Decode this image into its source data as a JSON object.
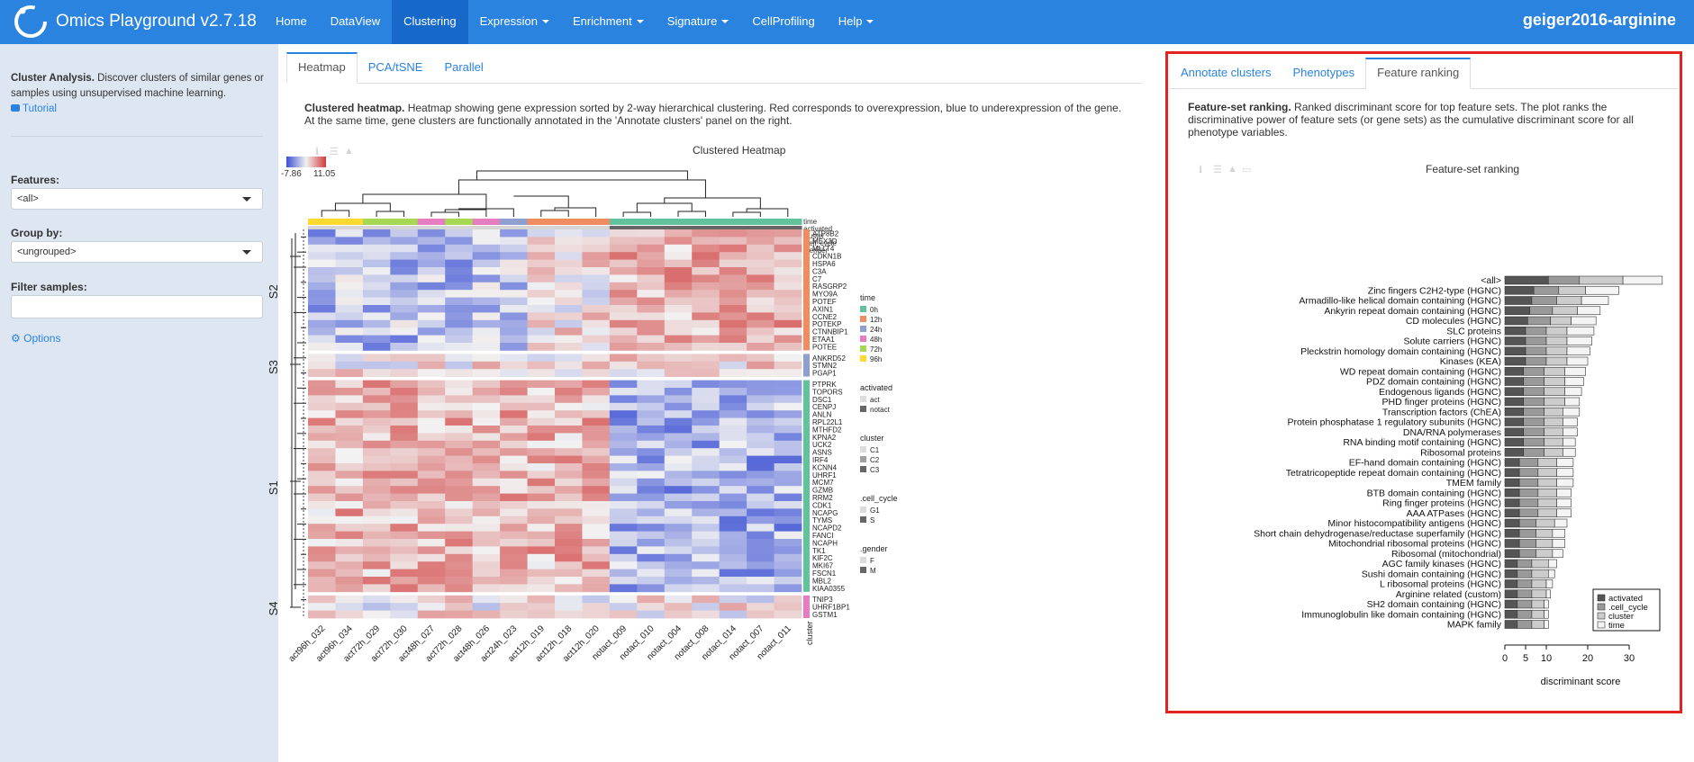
{
  "app": {
    "title": "Omics Playground v2.7.18",
    "dataset": "geiger2016-arginine"
  },
  "nav": [
    {
      "label": "Home",
      "dropdown": false
    },
    {
      "label": "DataView",
      "dropdown": false
    },
    {
      "label": "Clustering",
      "dropdown": false,
      "active": true
    },
    {
      "label": "Expression",
      "dropdown": true
    },
    {
      "label": "Enrichment",
      "dropdown": true
    },
    {
      "label": "Signature",
      "dropdown": true
    },
    {
      "label": "CellProfiling",
      "dropdown": false
    },
    {
      "label": "Help",
      "dropdown": true
    }
  ],
  "sidebar": {
    "intro_bold": "Cluster Analysis.",
    "intro_text": " Discover clusters of similar genes or samples using unsupervised machine learning.",
    "tutorial": "Tutorial",
    "features_label": "Features:",
    "features_value": "<all>",
    "group_label": "Group by:",
    "group_value": "<ungrouped>",
    "filter_label": "Filter samples:",
    "filter_value": "",
    "options": "Options"
  },
  "main_tabs": [
    "Heatmap",
    "PCA/tSNE",
    "Parallel"
  ],
  "heatmap": {
    "desc_bold": "Clustered heatmap.",
    "desc_text": " Heatmap showing gene expression sorted by 2-way hierarchical clustering. Red corresponds to overexpression, blue to underexpression of the gene. At the same time, gene clusters are functionally annotated in the 'Annotate clusters' panel on the right.",
    "title": "Clustered Heatmap",
    "scale_min": "-7.86",
    "scale_max": "11.05",
    "samples": [
      "act96h_032",
      "act96h_034",
      "act72h_029",
      "act72h_030",
      "act48h_027",
      "act72h_028",
      "act48h_026",
      "act24h_023",
      "act12h_019",
      "act12h_018",
      "act12h_020",
      "notact_009",
      "notact_010",
      "notact_004",
      "notact_008",
      "notact_014",
      "notact_007",
      "notact_011"
    ],
    "annotation_rows": [
      "time",
      "activated",
      "cluster",
      ".cell_cycle",
      ".gender"
    ],
    "gene_clusters": [
      {
        "name": "S2",
        "color": "#ef8c62",
        "genes": [
          "ATP8B2",
          "MEX3D",
          "MLLT4",
          "CDKN1B",
          "HSPA6",
          "C3A",
          "C7",
          "RASGRP2",
          "MYO9A",
          "POTEF",
          "AXIN1",
          "CCNE2",
          "POTEKP",
          "CTNNBIP1",
          "ETAA1",
          "POTEE"
        ]
      },
      {
        "name": "S3",
        "color": "#8e9fd0",
        "genes": [
          "ANKRD52",
          "STMN2",
          "PGAP1"
        ]
      },
      {
        "name": "S1",
        "color": "#62c29b",
        "genes": [
          "PTPRK",
          "TOPORS",
          "DSC1",
          "CENPJ",
          "ANLN",
          "RPL22L1",
          "MTHFD2",
          "KPNA2",
          "UCK2",
          "ASNS",
          "IRF4",
          "KCNN4",
          "UHRF1",
          "MCM7",
          "GZMB",
          "RRM2",
          "CDK1",
          "NCAPG",
          "TYMS",
          "NCAPD2",
          "FANCI",
          "NCAPH",
          "TK1",
          "KIF2C",
          "MKI67",
          "FSCN1",
          "MBL2",
          "KIAA0355"
        ]
      },
      {
        "name": "S4",
        "color": "#e57dc0",
        "genes": [
          "TNIP3",
          "UHRF1BP1",
          "GSTM1"
        ]
      }
    ],
    "cluster_axis_label": "cluster",
    "legends": [
      {
        "title": "time",
        "items": [
          {
            "label": "0h",
            "color": "#62c29b"
          },
          {
            "label": "12h",
            "color": "#ef8c62"
          },
          {
            "label": "24h",
            "color": "#8e9fd0"
          },
          {
            "label": "48h",
            "color": "#e57dc0"
          },
          {
            "label": "72h",
            "color": "#a6d854"
          },
          {
            "label": "96h",
            "color": "#ffd92f"
          }
        ]
      },
      {
        "title": "activated",
        "items": [
          {
            "label": "act",
            "color": "#dcdcdc"
          },
          {
            "label": "notact",
            "color": "#666666"
          }
        ]
      },
      {
        "title": "cluster",
        "items": [
          {
            "label": "C1",
            "color": "#dcdcdc"
          },
          {
            "label": "C2",
            "color": "#a0a0a0"
          },
          {
            "label": "C3",
            "color": "#666666"
          }
        ]
      },
      {
        "title": ".cell_cycle",
        "items": [
          {
            "label": "G1",
            "color": "#dcdcdc"
          },
          {
            "label": "S",
            "color": "#666666"
          }
        ]
      },
      {
        "title": ".gender",
        "items": [
          {
            "label": "F",
            "color": "#dcdcdc"
          },
          {
            "label": "M",
            "color": "#666666"
          }
        ]
      }
    ]
  },
  "right_tabs": [
    "Annotate clusters",
    "Phenotypes",
    "Feature ranking"
  ],
  "ranking": {
    "desc_bold": "Feature-set ranking.",
    "desc_text": " Ranked discriminant score for top feature sets. The plot ranks the discriminative power of feature sets (or gene sets) as the cumulative discriminant score for all phenotype variables.",
    "title": "Feature-set ranking",
    "xlabel": "discriminant score"
  },
  "chart_data": {
    "type": "bar",
    "orientation": "horizontal",
    "stacked": true,
    "title": "Feature-set ranking",
    "xlabel": "discriminant score",
    "ylabel": "",
    "xlim": [
      0,
      35
    ],
    "xticks": [
      0,
      5,
      10,
      20,
      30
    ],
    "legend_position": "bottom-right",
    "categories": [
      "<all>",
      "Zinc fingers C2H2-type (HGNC)",
      "Armadillo-like helical domain containing (HGNC)",
      "Ankyrin repeat domain containing (HGNC)",
      "CD molecules (HGNC)",
      "SLC proteins",
      "Solute carriers (HGNC)",
      "Pleckstrin homology domain containing (HGNC)",
      "Kinases (KEA)",
      "WD repeat domain containing (HGNC)",
      "PDZ domain containing (HGNC)",
      "Endogenous ligands (HGNC)",
      "PHD finger proteins (HGNC)",
      "Transcription factors (ChEA)",
      "Protein phosphatase 1 regulatory subunits (HGNC)",
      "DNA/RNA polymerases",
      "RNA binding motif containing (HGNC)",
      "Ribosomal proteins",
      "EF-hand domain containing (HGNC)",
      "Tetratricopeptide repeat domain containing (HGNC)",
      "TMEM family",
      "BTB domain containing (HGNC)",
      "Ring finger proteins (HGNC)",
      "AAA ATPases (HGNC)",
      "Minor histocompatibility antigens (HGNC)",
      "Short chain dehydrogenase/reductase superfamily (HGNC)",
      "Mitochondrial ribosomal proteins (HGNC)",
      "Ribosomal (mitochondrial)",
      "AGC family kinases (HGNC)",
      "Sushi domain containing (HGNC)",
      "L ribosomal proteins (HGNC)",
      "Arginine related (custom)",
      "SH2 domain containing (HGNC)",
      "Immunoglobulin like domain containing (HGNC)",
      "MAPK family"
    ],
    "series": [
      {
        "name": "activated",
        "color": "#555555",
        "values": [
          10.5,
          7,
          6.5,
          6,
          5.5,
          5,
          5,
          5,
          5,
          4.5,
          4.5,
          4.5,
          4.5,
          4.5,
          4.5,
          4.5,
          4.5,
          4.5,
          3.5,
          3.5,
          3.5,
          3.5,
          3.5,
          3.5,
          3.5,
          3.5,
          3.5,
          3.5,
          3,
          3,
          3,
          3,
          3,
          3,
          3
        ]
      },
      {
        "name": ".cell_cycle",
        "color": "#999999",
        "values": [
          7.5,
          6,
          6,
          5.5,
          5.5,
          5,
          5,
          5,
          5,
          5,
          5,
          5,
          5,
          5,
          5,
          5,
          5,
          5,
          4.5,
          4.5,
          4.5,
          4.5,
          4.5,
          4.5,
          4,
          4,
          4,
          4,
          3.5,
          3.5,
          3.5,
          3.5,
          3.5,
          3.5,
          3.5
        ]
      },
      {
        "name": "cluster",
        "color": "#cccccc",
        "values": [
          10.5,
          6.5,
          6,
          6,
          5,
          5,
          5,
          5,
          5,
          5,
          5,
          5,
          5,
          4.5,
          4.5,
          4.5,
          4.5,
          4.5,
          4.5,
          4.5,
          4.5,
          4.5,
          4.5,
          4.5,
          4.5,
          4,
          4,
          4,
          4,
          4,
          3.5,
          3.5,
          3,
          3,
          3
        ]
      },
      {
        "name": "time",
        "color": "#f4f4f4",
        "values": [
          9.5,
          8,
          6.5,
          5.5,
          6,
          6.5,
          6,
          5.5,
          5,
          5,
          4.5,
          4,
          3.5,
          4,
          3.5,
          3.5,
          3,
          3,
          4,
          4,
          4,
          3.5,
          3.5,
          3.5,
          3,
          3,
          3,
          2.5,
          2,
          1.5,
          1.5,
          1,
          1,
          1,
          1
        ]
      }
    ]
  }
}
